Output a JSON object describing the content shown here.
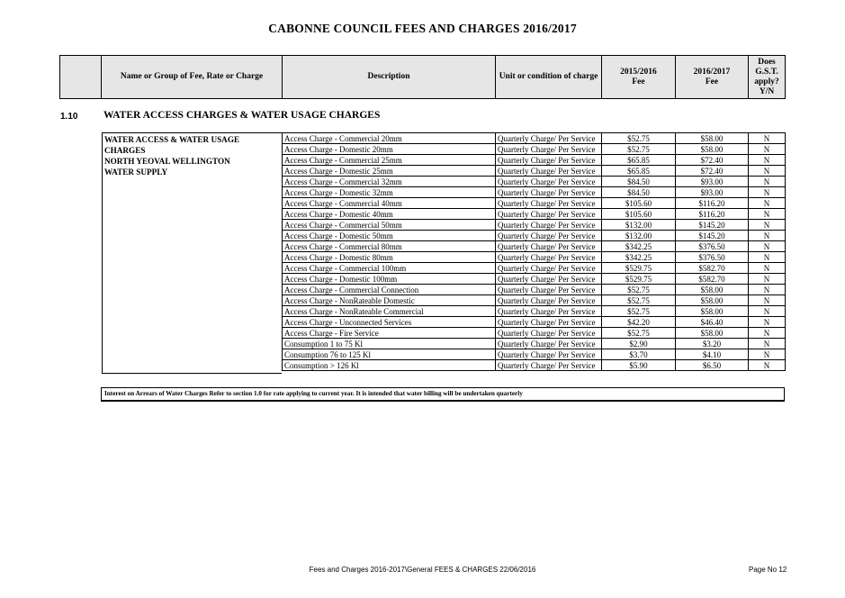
{
  "document": {
    "title": "CABONNE COUNCIL FEES AND CHARGES 2016/2017"
  },
  "header": {
    "col_blank": "",
    "col_name": "Name or Group of Fee, Rate or Charge",
    "col_description": "Description",
    "col_unit": "Unit or condition of charge",
    "col_fee_2015_line1": "2015/2016",
    "col_fee_2015_line2": "Fee",
    "col_fee_2016_line1": "2016/2017",
    "col_fee_2016_line2": "Fee",
    "col_gst_line1": "Does",
    "col_gst_line2": "G.S.T.",
    "col_gst_line3": "apply?",
    "col_gst_line4": "Y/N"
  },
  "section": {
    "number": "1.10",
    "title": "WATER ACCESS CHARGES & WATER USAGE CHARGES",
    "group_lines": [
      "WATER ACCESS & WATER USAGE",
      "CHARGES",
      "NORTH YEOVAL WELLINGTON",
      "WATER SUPPLY"
    ]
  },
  "rows": [
    {
      "description": "Access Charge - Commercial 20mm",
      "unit": "Quarterly Charge/ Per Service",
      "fee_2015": "$52.75",
      "fee_2016": "$58.00",
      "gst": "N"
    },
    {
      "description": "Access Charge - Domestic 20mm",
      "unit": "Quarterly Charge/ Per Service",
      "fee_2015": "$52.75",
      "fee_2016": "$58.00",
      "gst": "N"
    },
    {
      "description": "Access Charge - Commercial 25mm",
      "unit": "Quarterly Charge/ Per Service",
      "fee_2015": "$65.85",
      "fee_2016": "$72.40",
      "gst": "N"
    },
    {
      "description": "Access Charge - Domestic 25mm",
      "unit": "Quarterly Charge/ Per Service",
      "fee_2015": "$65.85",
      "fee_2016": "$72.40",
      "gst": "N"
    },
    {
      "description": "Access Charge - Commercial 32mm",
      "unit": "Quarterly Charge/ Per Service",
      "fee_2015": "$84.50",
      "fee_2016": "$93.00",
      "gst": "N"
    },
    {
      "description": "Access Charge - Domestic 32mm",
      "unit": "Quarterly Charge/ Per Service",
      "fee_2015": "$84.50",
      "fee_2016": "$93.00",
      "gst": "N"
    },
    {
      "description": "Access Charge - Commercial 40mm",
      "unit": "Quarterly Charge/ Per Service",
      "fee_2015": "$105.60",
      "fee_2016": "$116.20",
      "gst": "N"
    },
    {
      "description": "Access Charge - Domestic 40mm",
      "unit": "Quarterly Charge/ Per Service",
      "fee_2015": "$105.60",
      "fee_2016": "$116.20",
      "gst": "N"
    },
    {
      "description": "Access Charge - Commercial 50mm",
      "unit": "Quarterly Charge/ Per Service",
      "fee_2015": "$132.00",
      "fee_2016": "$145.20",
      "gst": "N"
    },
    {
      "description": "Access Charge - Domestic 50mm",
      "unit": "Quarterly Charge/ Per Service",
      "fee_2015": "$132.00",
      "fee_2016": "$145.20",
      "gst": "N"
    },
    {
      "description": "Access Charge - Commercial 80mm",
      "unit": "Quarterly Charge/ Per Service",
      "fee_2015": "$342.25",
      "fee_2016": "$376.50",
      "gst": "N"
    },
    {
      "description": "Access Charge - Domestic 80mm",
      "unit": "Quarterly Charge/ Per Service",
      "fee_2015": "$342.25",
      "fee_2016": "$376.50",
      "gst": "N"
    },
    {
      "description": "Access Charge - Commercial 100mm",
      "unit": "Quarterly Charge/ Per Service",
      "fee_2015": "$529.75",
      "fee_2016": "$582.70",
      "gst": "N"
    },
    {
      "description": "Access Charge - Domestic 100mm",
      "unit": "Quarterly Charge/ Per Service",
      "fee_2015": "$529.75",
      "fee_2016": "$582.70",
      "gst": "N"
    },
    {
      "description": "Access Charge - Commercial  Connection",
      "unit": "Quarterly Charge/ Per Service",
      "fee_2015": "$52.75",
      "fee_2016": "$58.00",
      "gst": "N"
    },
    {
      "description": "Access Charge - NonRateable Domestic",
      "unit": "Quarterly Charge/ Per Service",
      "fee_2015": "$52.75",
      "fee_2016": "$58.00",
      "gst": "N"
    },
    {
      "description": "Access Charge - NonRateable Commercial",
      "unit": "Quarterly Charge/ Per Service",
      "fee_2015": "$52.75",
      "fee_2016": "$58.00",
      "gst": "N"
    },
    {
      "description": "Access Charge - Unconnected Services",
      "unit": "Quarterly Charge/ Per Service",
      "fee_2015": "$42.20",
      "fee_2016": "$46.40",
      "gst": "N"
    },
    {
      "description": "Access Charge - Fire Service",
      "unit": "Quarterly Charge/ Per Service",
      "fee_2015": "$52.75",
      "fee_2016": "$58.00",
      "gst": "N"
    },
    {
      "description": "Consumption 1 to 75 Kl",
      "unit": "Quarterly Charge/ Per Service",
      "fee_2015": "$2.90",
      "fee_2016": "$3.20",
      "gst": "N"
    },
    {
      "description": "Consumption 76 to 125 Kl",
      "unit": "Quarterly Charge/ Per Service",
      "fee_2015": "$3.70",
      "fee_2016": "$4.10",
      "gst": "N"
    },
    {
      "description": "Consumption > 126 Kl",
      "unit": "Quarterly Charge/ Per Service",
      "fee_2015": "$5.90",
      "fee_2016": "$6.50",
      "gst": "N"
    }
  ],
  "note": "Interest on Arrears of Water Charges Refer to section 1.0 for rate applying to current year.  It is intended that water billing will be undertaken quarterly",
  "footer": {
    "path": "Fees and Charges 2016-2017\\General FEES & CHARGES 22/06/2016",
    "page": "Page No 12"
  }
}
